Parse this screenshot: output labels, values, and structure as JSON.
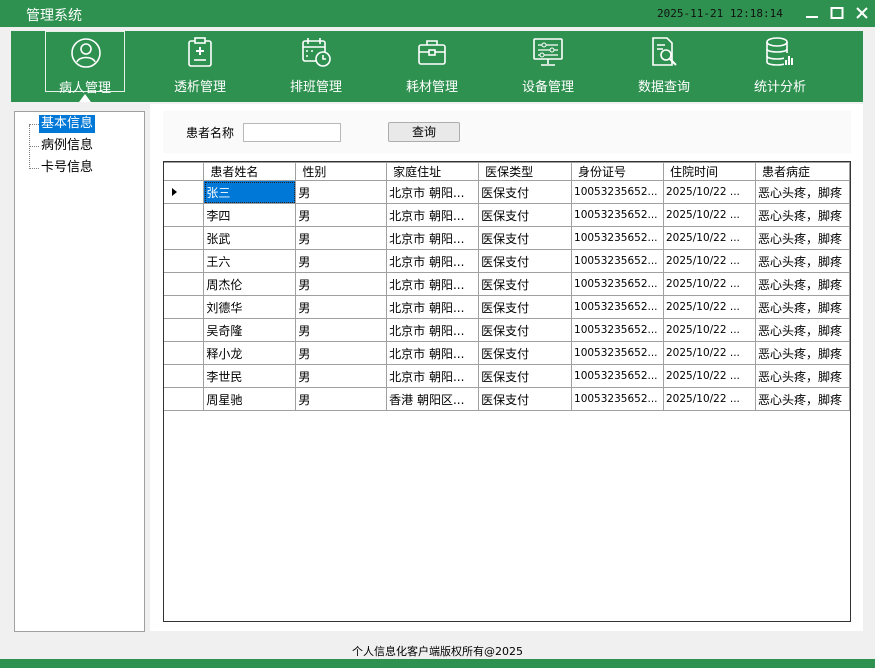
{
  "window": {
    "title": "管理系统",
    "clock": "2025-11-21 12:18:14"
  },
  "colors": {
    "brand_green": "#2e9150",
    "selection_blue": "#0078d7"
  },
  "toolbar": {
    "items": [
      {
        "label": "病人管理",
        "icon": "person-icon",
        "active": true
      },
      {
        "label": "透析管理",
        "icon": "clipboard-plus-icon"
      },
      {
        "label": "排班管理",
        "icon": "calendar-clock-icon"
      },
      {
        "label": "耗材管理",
        "icon": "briefcase-icon"
      },
      {
        "label": "设备管理",
        "icon": "monitor-settings-icon"
      },
      {
        "label": "数据查询",
        "icon": "document-search-icon"
      },
      {
        "label": "统计分析",
        "icon": "database-chart-icon"
      }
    ]
  },
  "tree": {
    "items": [
      {
        "label": "基本信息",
        "selected": true
      },
      {
        "label": "病例信息"
      },
      {
        "label": "卡号信息"
      }
    ]
  },
  "search": {
    "label": "患者名称",
    "value": "",
    "button": "查询"
  },
  "table": {
    "columns": [
      "患者姓名",
      "性别",
      "家庭住址",
      "医保类型",
      "身份证号",
      "住院时间",
      "患者病症"
    ],
    "rows": [
      [
        "张三",
        "男",
        "北京市 朝阳...",
        "医保支付",
        "10053235652...",
        "2025/10/22 ...",
        "恶心头疼，脚疼"
      ],
      [
        "李四",
        "男",
        "北京市 朝阳...",
        "医保支付",
        "10053235652...",
        "2025/10/22 ...",
        "恶心头疼，脚疼"
      ],
      [
        "张武",
        "男",
        "北京市 朝阳...",
        "医保支付",
        "10053235652...",
        "2025/10/22 ...",
        "恶心头疼，脚疼"
      ],
      [
        "王六",
        "男",
        "北京市 朝阳...",
        "医保支付",
        "10053235652...",
        "2025/10/22 ...",
        "恶心头疼，脚疼"
      ],
      [
        "周杰伦",
        "男",
        "北京市 朝阳...",
        "医保支付",
        "10053235652...",
        "2025/10/22 ...",
        "恶心头疼，脚疼"
      ],
      [
        "刘德华",
        "男",
        "北京市 朝阳...",
        "医保支付",
        "10053235652...",
        "2025/10/22 ...",
        "恶心头疼，脚疼"
      ],
      [
        "吴奇隆",
        "男",
        "北京市 朝阳...",
        "医保支付",
        "10053235652...",
        "2025/10/22 ...",
        "恶心头疼，脚疼"
      ],
      [
        "释小龙",
        "男",
        "北京市 朝阳...",
        "医保支付",
        "10053235652...",
        "2025/10/22 ...",
        "恶心头疼，脚疼"
      ],
      [
        "李世民",
        "男",
        "北京市 朝阳...",
        "医保支付",
        "10053235652...",
        "2025/10/22 ...",
        "恶心头疼，脚疼"
      ],
      [
        "周星驰",
        "男",
        "香港 朝阳区...",
        "医保支付",
        "10053235652...",
        "2025/10/22 ...",
        "恶心头疼，脚疼"
      ]
    ]
  },
  "footer": {
    "text": "个人信息化客户端版权所有@2025"
  }
}
